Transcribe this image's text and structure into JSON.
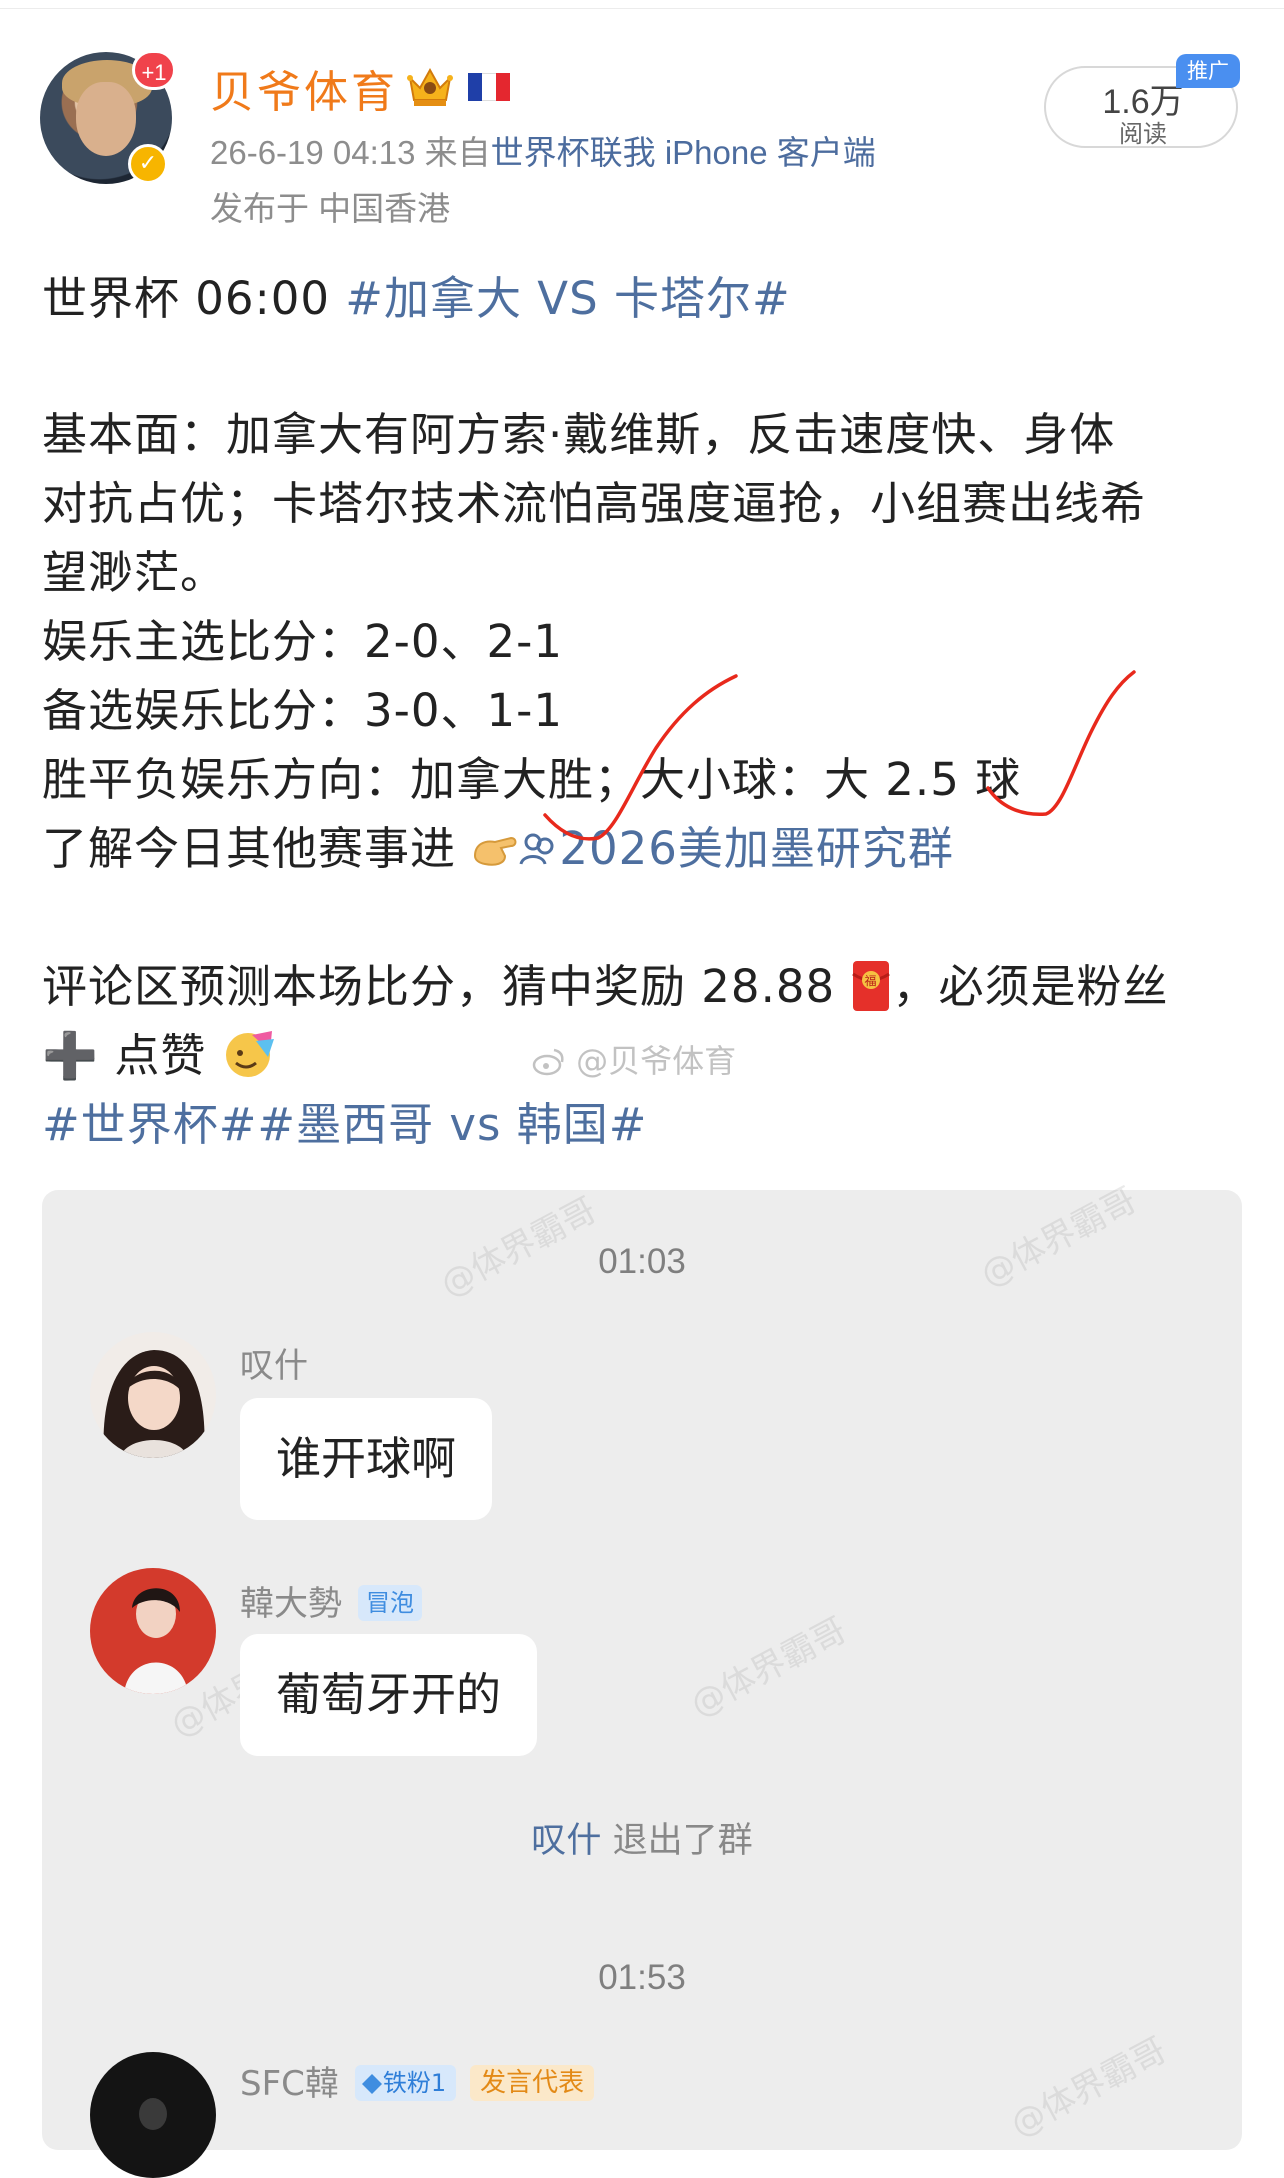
{
  "post": {
    "author": {
      "name": "贝爷体育",
      "notification_badge": "+1",
      "verified_mark": "✓",
      "avatar_icon": "avatar-photo",
      "crown_icon": "crown-badge-icon",
      "flag_icon": "france-flag-icon"
    },
    "meta": {
      "timestamp": "26-6-19 04:13",
      "source_prefix": "来自",
      "source_link": "世界杯联我 iPhone 客户端",
      "location": "发布于 中国香港"
    },
    "reads": {
      "count": "1.6万",
      "label": "阅读",
      "promo_tag": "推广"
    },
    "content": {
      "line1_prefix": "世界杯 06:00 ",
      "line1_topic": "#加拿大 VS 卡塔尔#",
      "line2": "基本面：加拿大有阿方索·戴维斯，反击速度快、身体",
      "line3": "对抗占优；卡塔尔技术流怕高强度逼抢，小组赛出线希",
      "line4": "望渺茫。",
      "line5": "娱乐主选比分：2-0、2-1",
      "line6": "备选娱乐比分：3-0、1-1",
      "line7": "胜平负娱乐方向：加拿大胜；大小球：大 2.5 球",
      "line8_prefix": "了解今日其他赛事进",
      "line8_link": "2026美加墨研究群",
      "line9_prefix": "评论区预测本场比分，猜中奖励 28.88",
      "line9_suffix": "，必须是粉丝",
      "line10_prefix": "➕ 点赞",
      "line11_topics": "#世界杯##墨西哥 vs 韩国#",
      "watermark": "@贝爷体育"
    }
  },
  "chat": {
    "time1": "01:03",
    "msg1": {
      "sender": "叹什",
      "text": "谁开球啊"
    },
    "msg2": {
      "sender": "韓大勢",
      "tag": "冒泡",
      "text": "葡萄牙开的"
    },
    "system": {
      "who": "叹什",
      "text": " 退出了群"
    },
    "time2": "01:53",
    "msg3": {
      "sender": "SFC韓",
      "fan_tag": "铁粉1",
      "role_tag": "发言代表"
    },
    "watermark": "@体界霸哥"
  },
  "colors": {
    "username": "#f07a1a",
    "link": "#4e6f9f",
    "annotation_red": "#e8291c",
    "chat_bg": "#ededed"
  }
}
